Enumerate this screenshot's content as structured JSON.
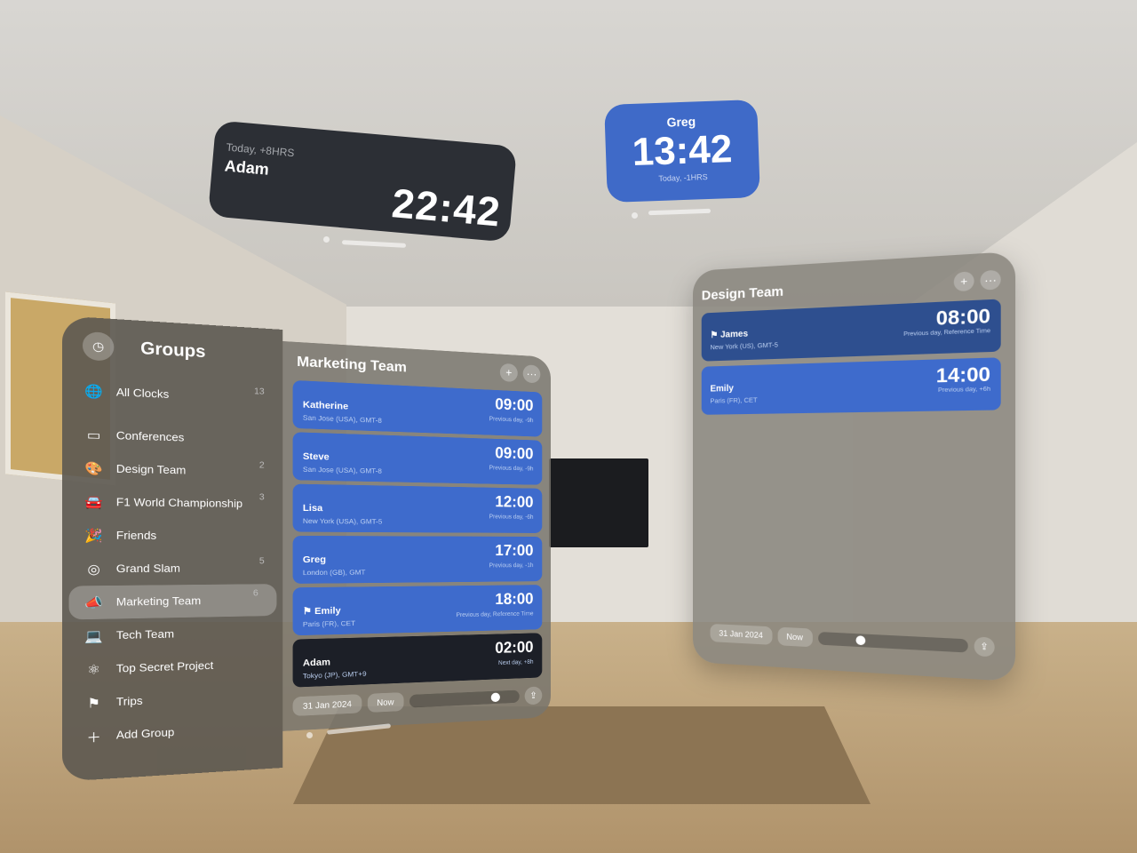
{
  "widgets": {
    "adam": {
      "subtitle": "Today, +8HRS",
      "name": "Adam",
      "time": "22:42"
    },
    "greg": {
      "name": "Greg",
      "time": "13:42",
      "subtitle": "Today, -1HRS"
    }
  },
  "sidebar": {
    "title": "Groups",
    "items": [
      {
        "label": "All Clocks",
        "count": "13",
        "icon": "globe-icon",
        "glyph": "🌐"
      },
      {
        "label": "Conferences",
        "count": "",
        "icon": "presentation-icon",
        "glyph": "▭"
      },
      {
        "label": "Design Team",
        "count": "2",
        "icon": "palette-icon",
        "glyph": "🎨"
      },
      {
        "label": "F1 World Championship",
        "count": "3",
        "icon": "car-icon",
        "glyph": "🚘"
      },
      {
        "label": "Friends",
        "count": "",
        "icon": "party-popper-icon",
        "glyph": "🎉"
      },
      {
        "label": "Grand Slam",
        "count": "5",
        "icon": "tennis-ball-icon",
        "glyph": "◎"
      },
      {
        "label": "Marketing Team",
        "count": "6",
        "icon": "megaphone-icon",
        "glyph": "📣",
        "selected": true
      },
      {
        "label": "Tech Team",
        "count": "",
        "icon": "laptop-icon",
        "glyph": "💻"
      },
      {
        "label": "Top Secret Project",
        "count": "",
        "icon": "atom-icon",
        "glyph": "⚛"
      },
      {
        "label": "Trips",
        "count": "",
        "icon": "signpost-icon",
        "glyph": "⚑"
      },
      {
        "label": "Add Group",
        "count": "",
        "icon": "add-icon",
        "glyph": "＋"
      }
    ]
  },
  "marketing": {
    "title": "Marketing Team",
    "add": "+",
    "more": "···",
    "clocks": [
      {
        "name": "Katherine",
        "location": "San Jose (USA), GMT-8",
        "time": "09:00",
        "delta": "Previous day, -9h"
      },
      {
        "name": "Steve",
        "location": "San Jose (USA), GMT-8",
        "time": "09:00",
        "delta": "Previous day, -9h"
      },
      {
        "name": "Lisa",
        "location": "New York (USA), GMT-5",
        "time": "12:00",
        "delta": "Previous day, -6h"
      },
      {
        "name": "Greg",
        "location": "London (GB), GMT",
        "time": "17:00",
        "delta": "Previous day, -1h"
      },
      {
        "name": "⚑ Emily",
        "location": "Paris (FR), CET",
        "time": "18:00",
        "delta": "Previous day, Reference Time"
      },
      {
        "name": "Adam",
        "location": "Tokyo (JP), GMT+9",
        "time": "02:00",
        "delta": "Next day, +8h"
      }
    ],
    "date": "31 Jan 2024",
    "now": "Now",
    "share": "⇪"
  },
  "design": {
    "title": "Design Team",
    "add": "+",
    "more": "···",
    "clocks": [
      {
        "name": "⚑ James",
        "location": "New York (US), GMT-5",
        "time": "08:00",
        "delta": "Previous day, Reference Time"
      },
      {
        "name": "Emily",
        "location": "Paris (FR), CET",
        "time": "14:00",
        "delta": "Previous day, +6h"
      }
    ],
    "date": "31 Jan 2024",
    "now": "Now",
    "share": "⇪"
  },
  "colors": {
    "accent": "#3e6bcc",
    "reference": "#2e4f8f",
    "dark": "#1c1f27"
  }
}
